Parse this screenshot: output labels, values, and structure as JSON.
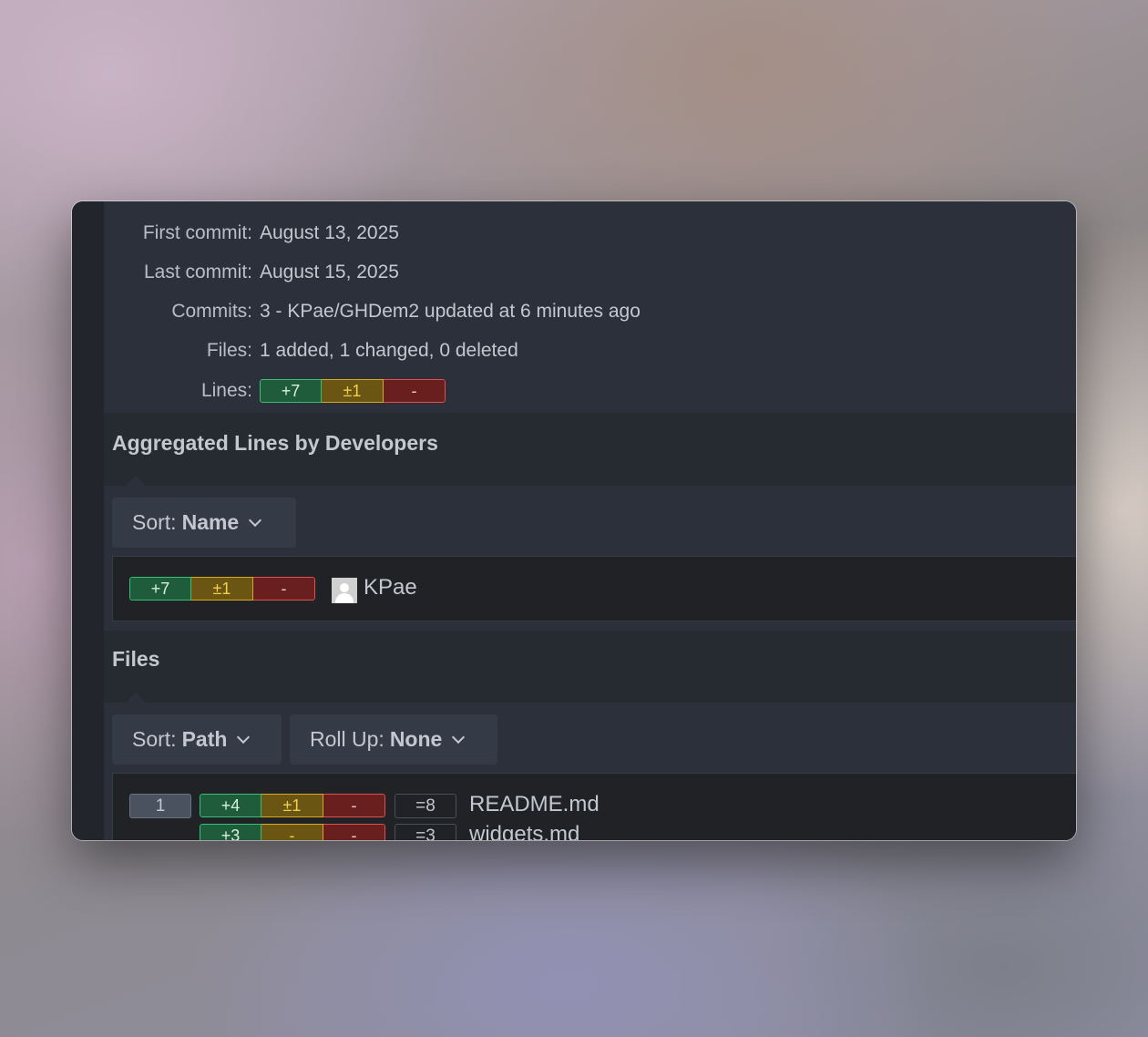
{
  "summary": {
    "first_commit_label": "First commit:",
    "first_commit_value": "August 13, 2025",
    "last_commit_label": "Last commit:",
    "last_commit_value": "August 15, 2025",
    "commits_label": "Commits:",
    "commits_value": "3 - KPae/GHDem2 updated at 6 minutes ago",
    "files_label": "Files:",
    "files_value": "1 added, 1 changed, 0 deleted",
    "lines_label": "Lines:",
    "lines": {
      "added": "+7",
      "changed": "±1",
      "deleted": "-"
    }
  },
  "developers": {
    "heading": "Aggregated Lines by Developers",
    "sort_label": "Sort:",
    "sort_value": "Name",
    "items": [
      {
        "name": "KPae",
        "added": "+7",
        "changed": "±1",
        "deleted": "-"
      }
    ]
  },
  "files": {
    "heading": "Files",
    "sort_label": "Sort:",
    "sort_value": "Path",
    "rollup_label": "Roll Up:",
    "rollup_value": "None",
    "items": [
      {
        "index": "1",
        "added": "+4",
        "changed": "±1",
        "deleted": "-",
        "total": "=8",
        "name": "README.md"
      },
      {
        "index": "",
        "added": "+3",
        "changed": "-",
        "deleted": "-",
        "total": "=3",
        "name": "widgets.md"
      }
    ]
  },
  "colors": {
    "added": "#3bbf76",
    "changed": "#d8a820",
    "deleted": "#e05050",
    "window_bg": "#262a31",
    "panel_bg": "#2b303a"
  },
  "icons": [
    "chevron-down-icon",
    "avatar-placeholder-icon"
  ]
}
